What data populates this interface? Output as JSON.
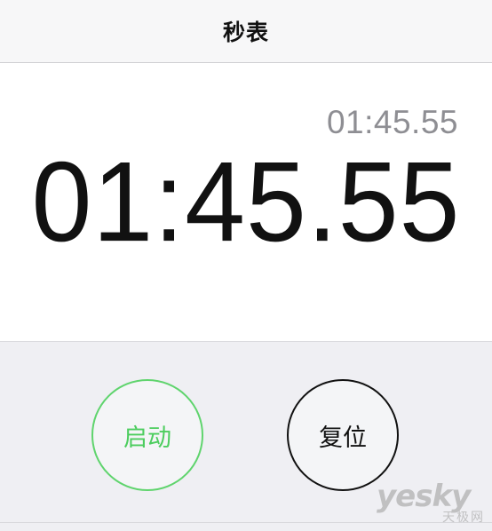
{
  "header": {
    "title": "秒表"
  },
  "display": {
    "lap_time": "01:45.55",
    "main_time": "01:45.55"
  },
  "controls": {
    "start_label": "启动",
    "reset_label": "复位",
    "start_color": "#4ccd5e",
    "reset_color": "#111111"
  },
  "watermark": {
    "brand": "yesky",
    "site": "天极网"
  }
}
